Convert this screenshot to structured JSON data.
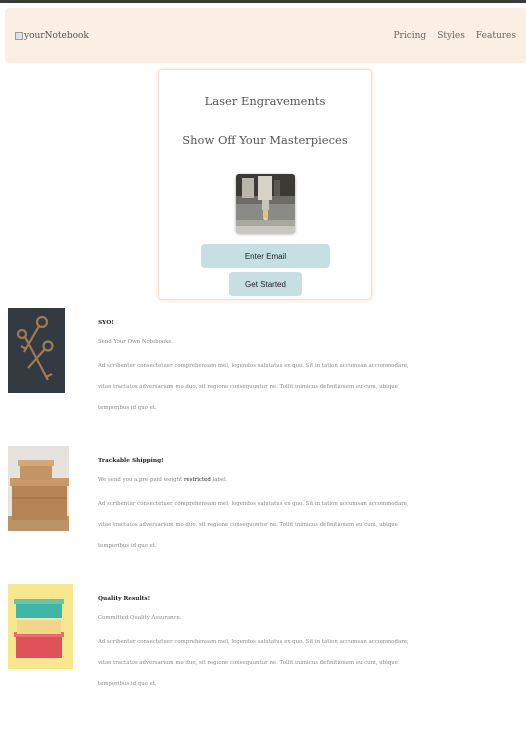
{
  "navbar": {
    "brand": "yourNotebook",
    "links": [
      "Pricing",
      "Styles",
      "Features"
    ]
  },
  "hero": {
    "title": "Laser Engravements",
    "subtitle": "Show Off Your Masterpieces",
    "image_icon": "laser-engraver-photo",
    "email_button": "Enter Email",
    "start_button": "Get Started"
  },
  "features": [
    {
      "heading": "SYO!",
      "lead": "Send Your Own Notebooks.",
      "lead_strong": "",
      "lead_after": "",
      "body": "Ad scribentur consectetuer comprehensam mel, legendos salutatus ex quo. Sit in tation accumsan accommodare, vitae tractatos adversarium mo duo, sit regione consequuntur ne. Tollit inimicus definitionem eu cum, ubique temporibus id quo et.",
      "image_icon": "vintage-keys-photo"
    },
    {
      "heading": "Trackable Shipping!",
      "lead": "We send you a pre-paid weight ",
      "lead_strong": "restricted",
      "lead_after": " label.",
      "body": "Ad scribentur consectetuer comprehensam mel, legendos salutatus ex quo. Sit in tation accumsan accommodare, vitae tractatos adversarium mo duo, sit regione consequuntur ne. Tollit inimicus definitionem eu cum, ubique temporibus id quo et.",
      "image_icon": "cardboard-boxes-photo"
    },
    {
      "heading": "Quality Results!",
      "lead": "Committed Quality Assurance.",
      "lead_strong": "",
      "lead_after": "",
      "body": "Ad scribentur consectetuer comprehensam mel, legendos salutatus ex quo. Sit in tation accumsan accommodare, vitae tractatos adversarium mo duo, sit regione consequuntur ne. Tollit inimicus definitionem eu cum, ubique temporibus id quo et.",
      "image_icon": "colorful-gift-boxes-photo"
    }
  ]
}
